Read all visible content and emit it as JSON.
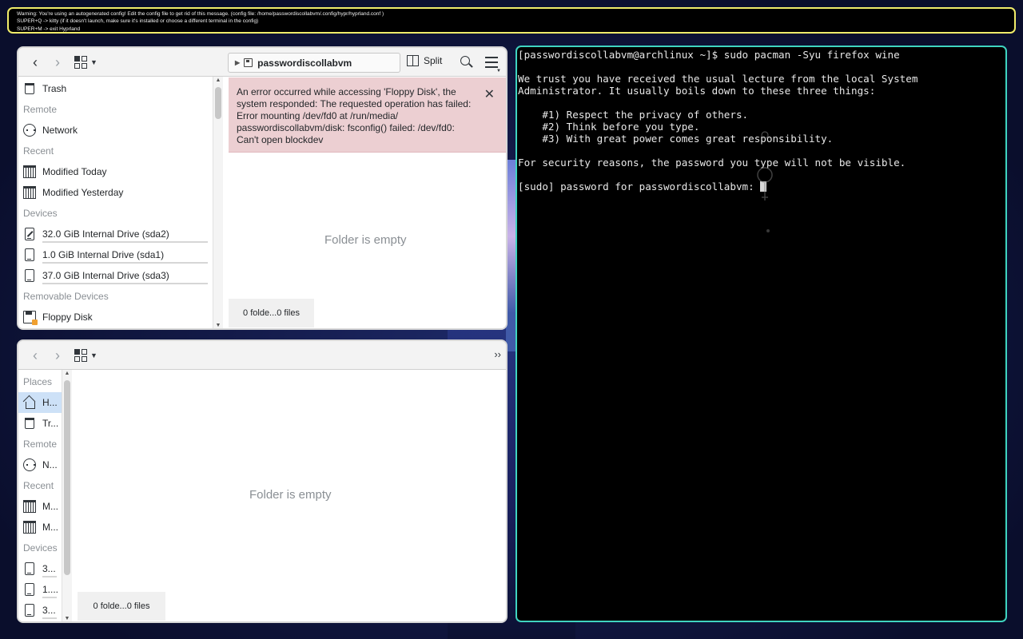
{
  "warning": {
    "lines": [
      "Warning: You're using an autogenerated config! Edit the config file to get rid of this message. (config file: /home/passwordiscollabvm/.config/hypr/hyprland.conf )",
      "SUPER+Q -> kitty (if it doesn't launch, make sure it's installed or choose a different terminal in the config)",
      "SUPER+M -> exit Hyprland"
    ]
  },
  "dolphin1": {
    "breadcrumb": "passwordiscollabvm",
    "split_label": "Split",
    "places": [
      {
        "type": "item",
        "icon": "trash-icon",
        "label": "Trash"
      },
      {
        "type": "head",
        "label": "Remote"
      },
      {
        "type": "item",
        "icon": "network-icon",
        "label": "Network"
      },
      {
        "type": "head",
        "label": "Recent"
      },
      {
        "type": "item",
        "icon": "calendar-icon",
        "label": "Modified Today"
      },
      {
        "type": "item",
        "icon": "calendar-icon",
        "label": "Modified Yesterday"
      },
      {
        "type": "head",
        "label": "Devices"
      },
      {
        "type": "drive",
        "icon": "drive-icon",
        "label": "32.0 GiB Internal Drive (sda2)",
        "usage": 0.0
      },
      {
        "type": "drive",
        "icon": "drive-icon",
        "label": "1.0 GiB Internal Drive (sda1)",
        "usage": 0.0
      },
      {
        "type": "drive",
        "icon": "drive-icon",
        "label": "37.0 GiB Internal Drive (sda3)",
        "usage": 0.0
      },
      {
        "type": "head",
        "label": "Removable Devices"
      },
      {
        "type": "item",
        "icon": "floppy-icon",
        "label": "Floppy Disk"
      }
    ],
    "error_message": "An error occurred while accessing 'Floppy Disk', the system responded: The requested operation has failed: Error mounting /dev/fd0 at /run/media/ passwordiscollabvm/disk: fsconfig() failed: /dev/fd0: Can't open blockdev",
    "empty_text": "Folder is empty",
    "status": "0 folde...0 files"
  },
  "dolphin2": {
    "more_label": "››",
    "places": [
      {
        "type": "head",
        "label": "Places"
      },
      {
        "type": "item",
        "icon": "home-icon",
        "label": "H...",
        "selected": true
      },
      {
        "type": "item",
        "icon": "trash-icon",
        "label": "Tr..."
      },
      {
        "type": "head",
        "label": "Remote"
      },
      {
        "type": "item",
        "icon": "network-icon",
        "label": "N..."
      },
      {
        "type": "head",
        "label": "Recent"
      },
      {
        "type": "item",
        "icon": "calendar-icon",
        "label": "M..."
      },
      {
        "type": "item",
        "icon": "calendar-icon",
        "label": "M..."
      },
      {
        "type": "head",
        "label": "Devices"
      },
      {
        "type": "drive",
        "icon": "drive-icon",
        "label": "3...",
        "usage": 0.0
      },
      {
        "type": "drive",
        "icon": "drive-icon",
        "label": "1....",
        "usage": 0.0
      },
      {
        "type": "drive",
        "icon": "drive-icon",
        "label": "3...",
        "usage": 0.0
      }
    ],
    "empty_text": "Folder is empty",
    "status": "0 folde...0 files"
  },
  "terminal": {
    "lines": [
      "[passwordiscollabvm@archlinux ~]$ sudo pacman -Syu firefox wine",
      "",
      "We trust you have received the usual lecture from the local System",
      "Administrator. It usually boils down to these three things:",
      "",
      "    #1) Respect the privacy of others.",
      "    #2) Think before you type.",
      "    #3) With great power comes great responsibility.",
      "",
      "For security reasons, the password you type will not be visible.",
      ""
    ],
    "prompt": "[sudo] password for passwordiscollabvm: "
  },
  "colors": {
    "warning_border": "#f0ec6a",
    "terminal_border": "#3fd4c0",
    "error_bg": "#eccfd2",
    "selection": "#cde1f7"
  }
}
